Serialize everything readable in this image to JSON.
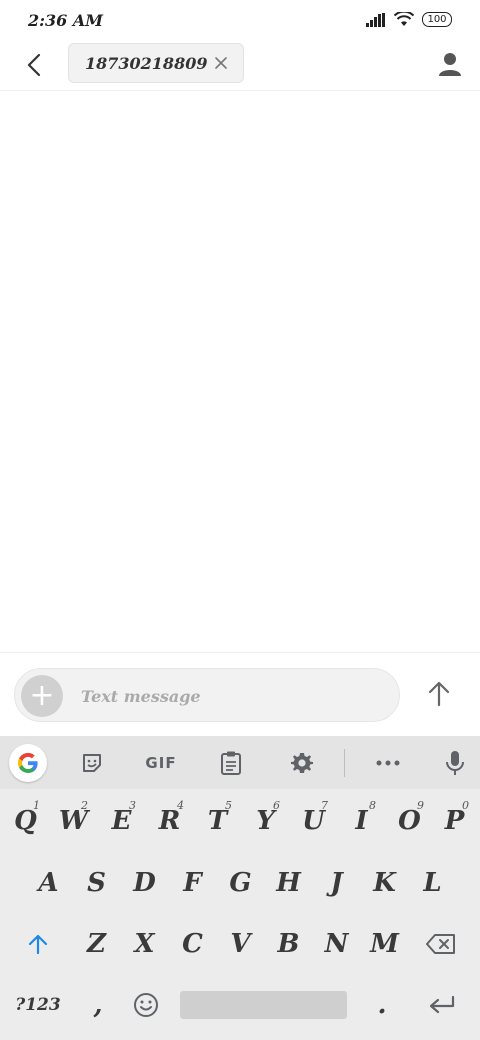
{
  "status": {
    "time": "2:36 AM",
    "battery": "100"
  },
  "header": {
    "recipient": "18730218809"
  },
  "composer": {
    "placeholder": "Text message"
  },
  "toolbar": {
    "gif_label": "GIF"
  },
  "keyboard": {
    "row1": [
      {
        "key": "Q",
        "hint": "1"
      },
      {
        "key": "W",
        "hint": "2"
      },
      {
        "key": "E",
        "hint": "3"
      },
      {
        "key": "R",
        "hint": "4"
      },
      {
        "key": "T",
        "hint": "5"
      },
      {
        "key": "Y",
        "hint": "6"
      },
      {
        "key": "U",
        "hint": "7"
      },
      {
        "key": "I",
        "hint": "8"
      },
      {
        "key": "O",
        "hint": "9"
      },
      {
        "key": "P",
        "hint": "0"
      }
    ],
    "row2": [
      "A",
      "S",
      "D",
      "F",
      "G",
      "H",
      "J",
      "K",
      "L"
    ],
    "row3": [
      "Z",
      "X",
      "C",
      "V",
      "B",
      "N",
      "M"
    ],
    "row4": {
      "symbols": "?123",
      "comma": ",",
      "period": "."
    }
  },
  "colors": {
    "accent": "#1e88e5",
    "keyboard_bg": "#ececec",
    "toolbar_bg": "#e4e4e4"
  }
}
